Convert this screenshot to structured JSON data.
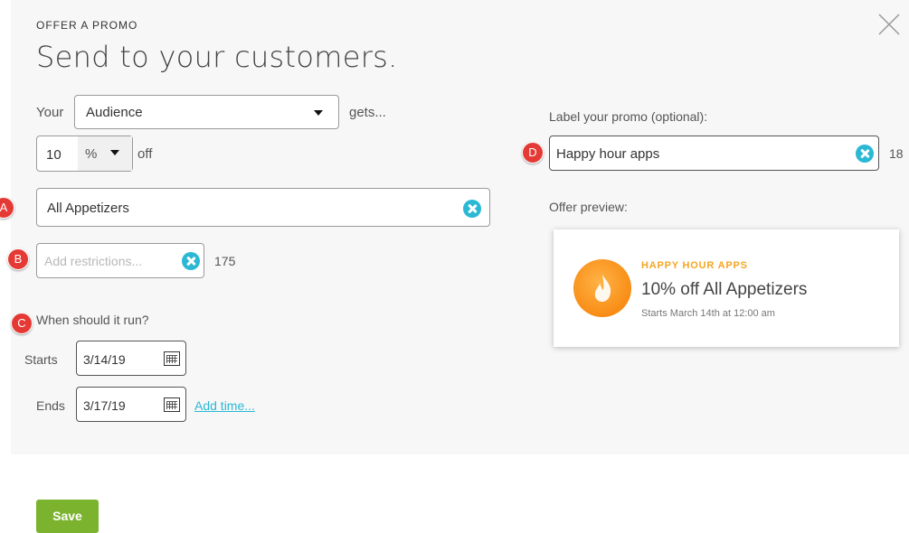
{
  "header": {
    "eyebrow": "OFFER A PROMO",
    "title": "Send to your customers."
  },
  "audience": {
    "prefix": "Your",
    "selected": "Audience",
    "suffix": "gets..."
  },
  "discount": {
    "amount": "10",
    "unit": "%",
    "suffix": "off"
  },
  "item_field": {
    "value": "All Appetizers"
  },
  "restrictions_field": {
    "placeholder": "Add restrictions...",
    "char_count": "175"
  },
  "schedule": {
    "question": "When should it run?",
    "starts_label": "Starts",
    "starts_value": "3/14/19",
    "ends_label": "Ends",
    "ends_value": "3/17/19",
    "add_time_link": "Add time..."
  },
  "promo_label": {
    "label": "Label your promo (optional):",
    "value": "Happy hour apps",
    "char_count": "18"
  },
  "preview": {
    "label": "Offer preview:",
    "heading": "HAPPY HOUR APPS",
    "offer": "10% off All Appetizers",
    "starts": "Starts March 14th at 12:00 am"
  },
  "markers": {
    "a": "A",
    "b": "B",
    "c": "C",
    "d": "D"
  },
  "save_button": "Save",
  "icons": {
    "close": "close-icon",
    "clear": "clear-icon",
    "calendar": "calendar-icon",
    "flame": "flame-icon",
    "caret": "caret-down-icon"
  },
  "colors": {
    "accent": "#2bb8d4",
    "save": "#7bb32e",
    "marker": "#e53935",
    "preview_heading": "#f5a623"
  }
}
